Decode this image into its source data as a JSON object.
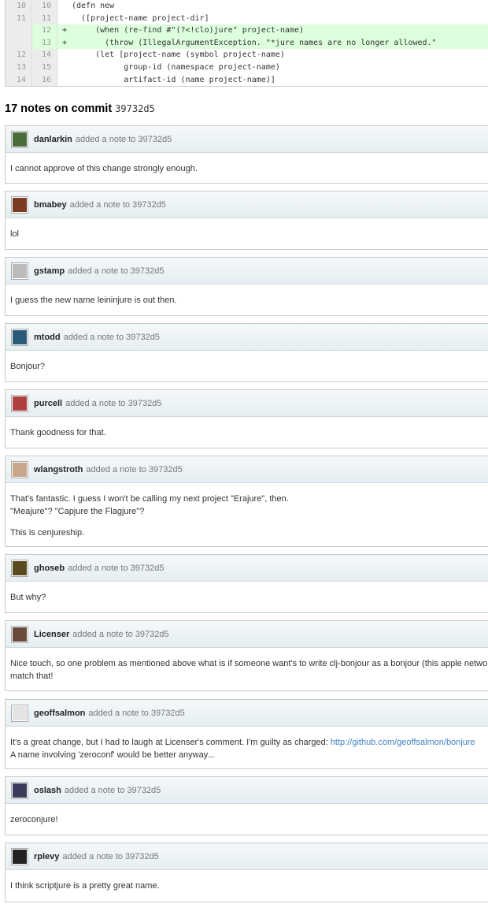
{
  "diff": {
    "lines": [
      {
        "old": "10",
        "new": "10",
        "marker": "",
        "text": "(defn new",
        "type": "ctx"
      },
      {
        "old": "11",
        "new": "11",
        "marker": "",
        "text": "  ([project-name project-dir]",
        "type": "ctx"
      },
      {
        "old": "",
        "new": "12",
        "marker": "+",
        "text": "     (when (re-find #\"(?<!clo)jure\" project-name)",
        "type": "add"
      },
      {
        "old": "",
        "new": "13",
        "marker": "+",
        "text": "       (throw (IllegalArgumentException. \"*jure names are no longer allowed.\"",
        "type": "add"
      },
      {
        "old": "12",
        "new": "14",
        "marker": "",
        "text": "     (let [project-name (symbol project-name)",
        "type": "ctx"
      },
      {
        "old": "13",
        "new": "15",
        "marker": "",
        "text": "           group-id (namespace project-name)",
        "type": "ctx"
      },
      {
        "old": "14",
        "new": "16",
        "marker": "",
        "text": "           artifact-id (name project-name)]",
        "type": "ctx"
      }
    ]
  },
  "heading": {
    "count_text": "17 notes on commit",
    "sha": "39732d5"
  },
  "notes": [
    {
      "author": "danlarkin",
      "meta": "added a note to 39732d5",
      "avatar_color": "#4b6b3a",
      "paragraphs": [
        "I cannot approve of this change strongly enough."
      ]
    },
    {
      "author": "bmabey",
      "meta": "added a note to 39732d5",
      "avatar_color": "#7a3b20",
      "paragraphs": [
        "lol"
      ]
    },
    {
      "author": "gstamp",
      "meta": "added a note to 39732d5",
      "avatar_color": "#bbbbbb",
      "paragraphs": [
        "I guess the new name leininjure is out then."
      ]
    },
    {
      "author": "mtodd",
      "meta": "added a note to 39732d5",
      "avatar_color": "#2b5b7a",
      "paragraphs": [
        "Bonjour?"
      ]
    },
    {
      "author": "purcell",
      "meta": "added a note to 39732d5",
      "avatar_color": "#b04040",
      "paragraphs": [
        "Thank goodness for that."
      ]
    },
    {
      "author": "wlangstroth",
      "meta": "added a note to 39732d5",
      "avatar_color": "#c9a58a",
      "paragraphs": [
        "That's fantastic. I guess I won't be calling my next project \"Erajure\", then.\n\"Meajure\"? \"Capjure the Flagjure\"?",
        "This is cenjureship."
      ]
    },
    {
      "author": "ghoseb",
      "meta": "added a note to 39732d5",
      "avatar_color": "#5a4a20",
      "paragraphs": [
        "But why?"
      ]
    },
    {
      "author": "Licenser",
      "meta": "added a note to 39732d5",
      "avatar_color": "#6a4a3a",
      "paragraphs": [
        "Nice touch, so one problem as mentioned above what is if someone want's to write clj-bonjour as a bonjour (this apple network s\nmatch that!"
      ]
    },
    {
      "author": "geoffsalmon",
      "meta": "added a note to 39732d5",
      "avatar_color": "#e4e4e4",
      "paragraphs": [
        "It's a great change, but I had to laugh at Licenser's comment. I'm guilty as charged: ",
        "A name involving 'zeroconf' would be better anyway..."
      ],
      "link": "http://github.com/geoffsalmon/bonjure"
    },
    {
      "author": "oslash",
      "meta": "added a note to 39732d5",
      "avatar_color": "#3a3a5a",
      "paragraphs": [
        "zeroconjure!"
      ]
    },
    {
      "author": "rplevy",
      "meta": "added a note to 39732d5",
      "avatar_color": "#222222",
      "paragraphs": [
        "I think scriptjure is a pretty great name."
      ]
    }
  ]
}
